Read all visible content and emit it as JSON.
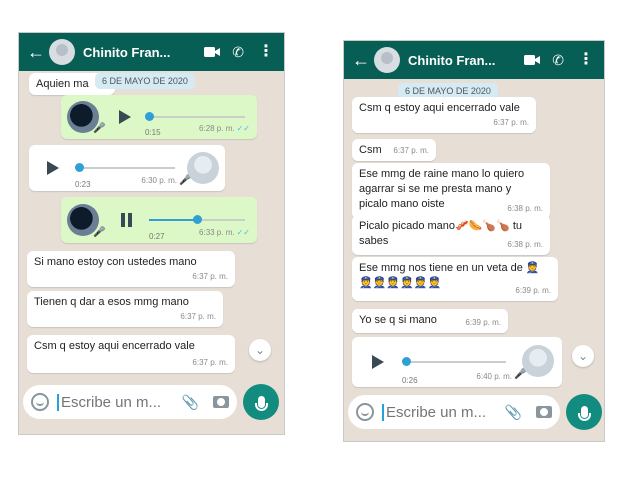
{
  "left": {
    "header": {
      "name": "Chinito Fran..."
    },
    "date": "6 DE MAYO DE 2020",
    "partial_text": "Aquien ma",
    "audio1": {
      "duration": "0:15",
      "time": "6:28 p. m.",
      "ticks": "✓✓"
    },
    "audio2": {
      "duration": "0:23",
      "time": "6:30 p. m."
    },
    "audio3": {
      "duration": "0:27",
      "time": "6:33 p. m.",
      "ticks": "✓✓"
    },
    "messages": [
      {
        "text": "Si mano estoy con ustedes mano",
        "time": "6:37 p. m."
      },
      {
        "text": "Tienen q dar a esos mmg mano",
        "time": "6:37 p. m."
      },
      {
        "text": "Csm q estoy aqui encerrado vale",
        "time": "6:37 p. m."
      }
    ],
    "composer": {
      "placeholder": "Escribe un m..."
    }
  },
  "right": {
    "header": {
      "name": "Chinito Fran..."
    },
    "date": "6 DE MAYO DE 2020",
    "messages": [
      {
        "text": "Csm q estoy aqui encerrado vale",
        "time": "6:37 p. m."
      },
      {
        "text": "Csm",
        "time": "6:37 p. m."
      },
      {
        "text": "Ese mmg de raine mano lo quiero agarrar si se me presta mano y picalo mano oiste",
        "time": "6:38 p. m."
      },
      {
        "text": "Picalo picado mano🥓🌭🍗🍗 tu sabes",
        "time": "6:38 p. m."
      },
      {
        "text": "Ese mmg nos tiene en un veta de 👮👮👮👮👮👮👮",
        "time": "6:39 p. m."
      },
      {
        "text": "Yo se q si mano",
        "time": "6:39 p. m."
      }
    ],
    "audio": {
      "duration": "0:26",
      "time": "6:40 p. m."
    },
    "composer": {
      "placeholder": "Escribe un m..."
    }
  },
  "icons": {
    "back": "arrow-left-icon",
    "video": "video-camera-icon",
    "call": "phone-icon",
    "menu": "more-vertical-icon",
    "emoji": "emoji-icon",
    "attach": "paperclip-icon",
    "camera": "camera-icon",
    "mic": "microphone-icon",
    "play": "play-icon",
    "pause": "pause-icon",
    "scroll": "chevron-double-down-icon"
  },
  "colors": {
    "header": "#075e54",
    "chat_bg": "#e7dfd6",
    "outgoing": "#dcf8c6",
    "incoming": "#ffffff",
    "mic_button": "#128c7e",
    "audio_accent": "#2fa0d6"
  }
}
